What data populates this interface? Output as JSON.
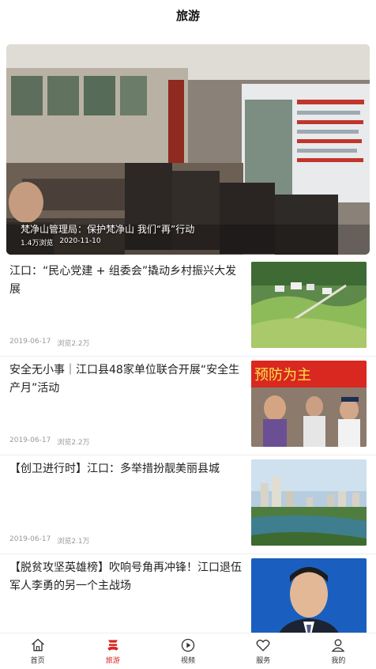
{
  "header": {
    "title": "旅游"
  },
  "hero": {
    "title": "梵净山管理局：保护梵净山 我们“再”行动",
    "views": "1.4万浏览",
    "date": "2020-11-10"
  },
  "articles": [
    {
      "title": "江口：“民心党建 + 组委会”撬动乡村振兴大发展",
      "date": "2019-06-17",
      "views": "浏览2.2万"
    },
    {
      "title": "安全无小事｜江口县48家单位联合开展“安全生产月”活动",
      "date": "2019-06-17",
      "views": "浏览2.2万",
      "thumb_text": "预防为主"
    },
    {
      "title": "【创卫进行时】江口：多举措扮靓美丽县城",
      "date": "2019-06-17",
      "views": "浏览2.1万"
    },
    {
      "title": "【脱贫攻坚英雄榜】吹响号角再冲锋！江口退伍军人李勇的另一个主战场"
    }
  ],
  "tabbar": {
    "items": [
      {
        "label": "首页",
        "icon": "home-icon"
      },
      {
        "label": "旅游",
        "icon": "travel-icon",
        "active": true
      },
      {
        "label": "视频",
        "icon": "play-icon"
      },
      {
        "label": "服务",
        "icon": "heart-icon"
      },
      {
        "label": "我的",
        "icon": "user-icon"
      }
    ]
  },
  "colors": {
    "accent": "#d9241c",
    "meta_text": "#999999",
    "divider": "#eeeeee"
  }
}
